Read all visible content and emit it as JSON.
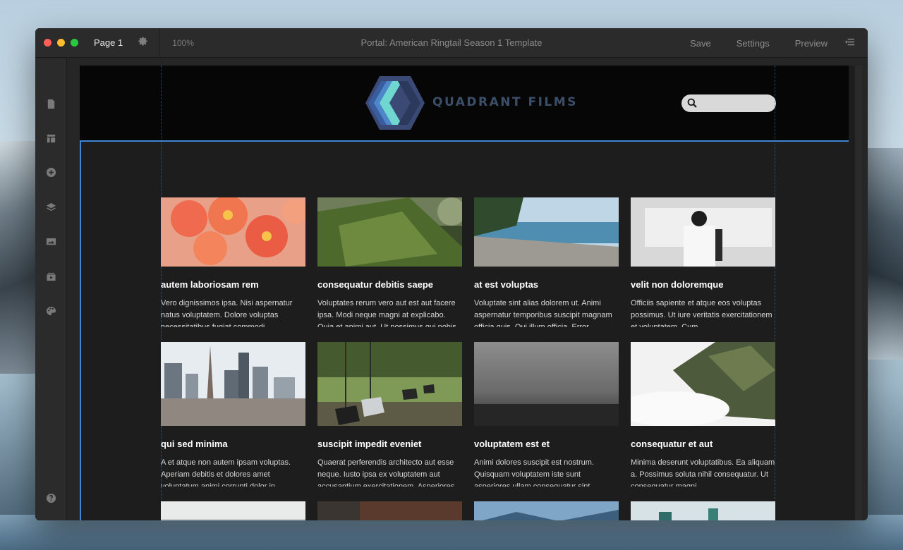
{
  "window": {
    "page_label": "Page 1",
    "zoom": "100%",
    "document_title": "Portal: American Ringtail Season 1 Template",
    "actions": {
      "save": "Save",
      "settings": "Settings",
      "preview": "Preview"
    }
  },
  "traffic_lights": {
    "close": "#ff5f57",
    "minimize": "#febc2e",
    "zoom": "#28c840"
  },
  "sidebar": {
    "top_icons": [
      "page-icon",
      "layout-icon",
      "add-icon",
      "layers-icon",
      "image-icon",
      "media-icon",
      "palette-icon"
    ],
    "bottom_icons": [
      "help-icon",
      "logout-icon"
    ]
  },
  "site": {
    "brand": "QUADRANT FILMS",
    "colors": {
      "brand": "#3c4f69",
      "logo_dark": "#3a5590",
      "logo_mid": "#4d86c9",
      "logo_light": "#6fd6d0",
      "selection": "#3f86d4"
    }
  },
  "cards": [
    {
      "title": "autem laboriosam rem",
      "text": "Vero dignissimos ipsa. Nisi aspernatur natus voluptatem. Dolore voluptas necessitatibus fugiat commodi."
    },
    {
      "title": "consequatur debitis saepe",
      "text": "Voluptates rerum vero aut est aut facere ipsa. Modi neque magni at explicabo. Quia et animi aut. Ut possimus qui nobis."
    },
    {
      "title": "at est voluptas",
      "text": "Voluptate sint alias dolorem ut. Animi aspernatur temporibus suscipit magnam officia quis. Qui illum officia. Error."
    },
    {
      "title": "velit non doloremque",
      "text": "Officiis sapiente et atque eos voluptas possimus. Ut iure veritatis exercitationem et voluptatem. Cum."
    },
    {
      "title": "qui sed minima",
      "text": "A et atque non autem ipsam voluptas. Aperiam debitis et dolores amet voluptatum animi corrupti dolor in."
    },
    {
      "title": "suscipit impedit eveniet",
      "text": "Quaerat perferendis architecto aut esse neque. Iusto ipsa ex voluptatem aut accusantium exercitationem. Asperiores."
    },
    {
      "title": "voluptatem est et",
      "text": "Animi dolores suscipit est nostrum. Quisquam voluptatem iste sunt asperiores ullam consequatur sint."
    },
    {
      "title": "consequatur et aut",
      "text": "Minima deserunt voluptatibus. Ea aliquam a. Possimus soluta nihil consequatur. Ut consequatur magni."
    }
  ]
}
